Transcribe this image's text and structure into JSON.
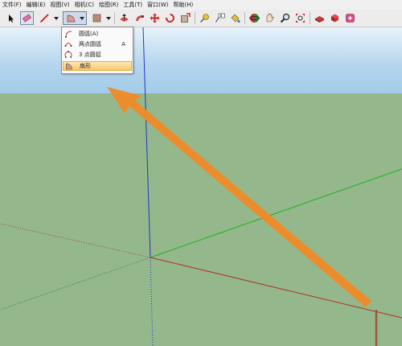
{
  "menu": [
    "文件(F)",
    "编辑(E)",
    "视图(V)",
    "相机(C)",
    "绘图(R)",
    "工具(T)",
    "窗口(W)",
    "帮助(H)"
  ],
  "toolbar": {
    "tools": [
      "select-icon",
      "eraser-icon",
      "pencil-icon",
      "sector-icon",
      "rectangle-icon",
      "push-pull-icon",
      "follow-me-icon",
      "move-icon",
      "rotate-icon",
      "offset-icon",
      "tape-measure-icon",
      "text-icon",
      "paint-bucket-icon",
      "orbit-icon",
      "pan-icon",
      "zoom-icon",
      "zoom-extents-icon",
      "warehouse-icon",
      "components-icon",
      "extension-icon"
    ]
  },
  "arc_menu": {
    "items": [
      {
        "label": "圆弧(A)",
        "shortcut": "",
        "icon": "arc-icon",
        "highlighted": false
      },
      {
        "label": "两点圆弧",
        "shortcut": "A",
        "icon": "two-point-arc-icon",
        "highlighted": false
      },
      {
        "label": "3 点圆弧",
        "shortcut": "",
        "icon": "three-point-arc-icon",
        "highlighted": false
      },
      {
        "label": "扇形",
        "shortcut": "",
        "icon": "pie-icon",
        "highlighted": true
      }
    ]
  },
  "colors": {
    "sky": "#b6d6ee",
    "ground": "#94b88c",
    "arrow": "#f08a28",
    "highlight": "#f7c96a"
  }
}
